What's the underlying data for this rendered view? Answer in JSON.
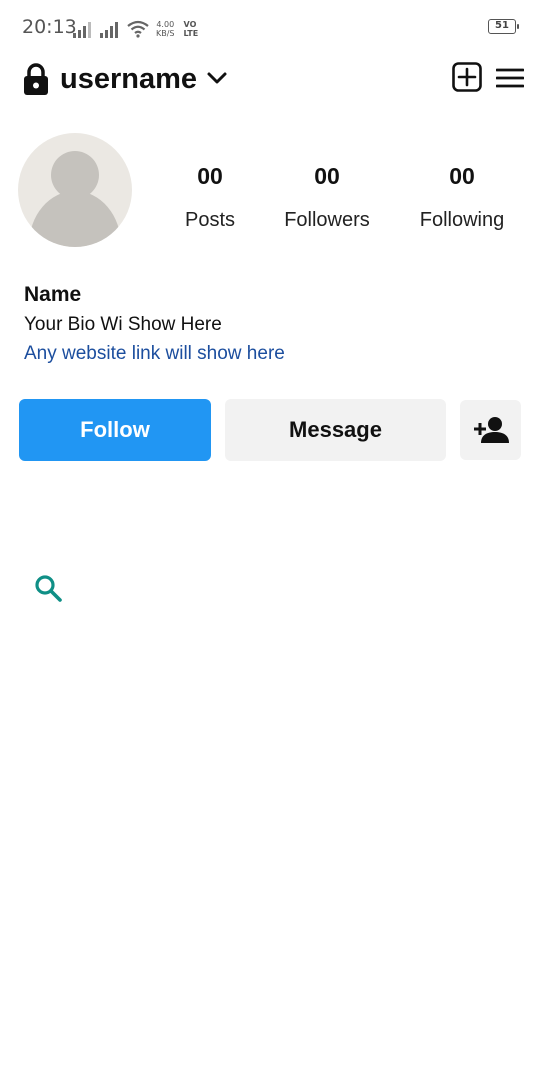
{
  "status_bar": {
    "time": "20:13",
    "net_speed_value": "4.00",
    "net_speed_unit": "KB/S",
    "volte_top": "VO",
    "volte_bottom": "LTE",
    "battery_level": "51",
    "icons": [
      "signal-icon",
      "signal-icon",
      "wifi-icon",
      "battery-icon"
    ]
  },
  "header": {
    "username": "username",
    "icons": [
      "lock-icon",
      "chevron-down-icon",
      "add-post-icon",
      "menu-icon"
    ]
  },
  "profile": {
    "stats": [
      {
        "value": "00",
        "label": "Posts"
      },
      {
        "value": "00",
        "label": "Followers"
      },
      {
        "value": "00",
        "label": "Following"
      }
    ],
    "name": "Name",
    "bio": "Your Bio Wi Show Here",
    "link": "Any website link will show here"
  },
  "actions": {
    "follow_label": "Follow",
    "message_label": "Message"
  },
  "colors": {
    "accent": "#2196f3",
    "link": "#1c4e9e",
    "search_icon": "#0f8f86",
    "button_gray": "#f2f2f2"
  }
}
